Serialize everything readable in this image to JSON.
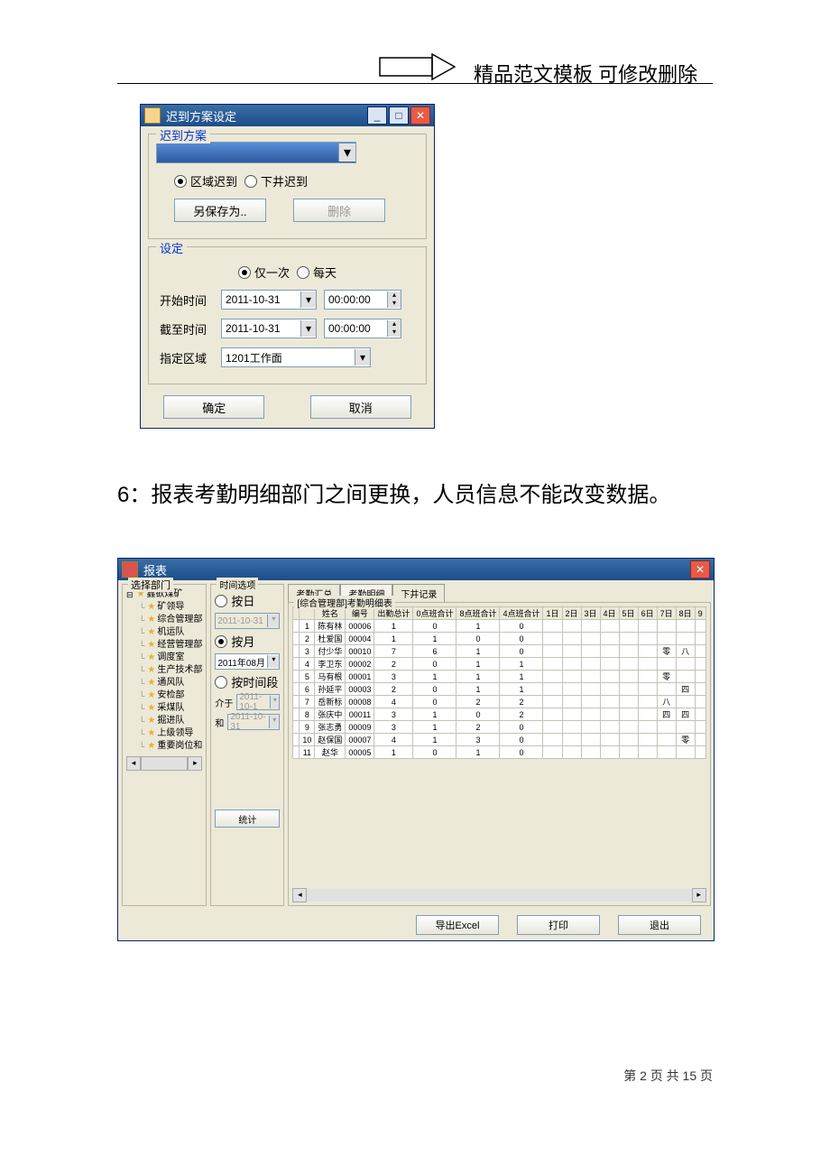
{
  "header": {
    "text": "精品范文模板  可修改删除"
  },
  "body_text": "6：报表考勤明细部门之间更换，人员信息不能改变数据。",
  "footer": {
    "page_current": "2",
    "page_total": "15",
    "template": "第 {c} 页 共 {t} 页"
  },
  "dialog1": {
    "title": "迟到方案设定",
    "group1_title": "迟到方案",
    "radio_area": "区域迟到",
    "radio_down": "下井迟到",
    "btn_saveas": "另保存为..",
    "btn_delete": "删除",
    "group2_title": "设定",
    "radio_once": "仅一次",
    "radio_daily": "每天",
    "label_start": "开始时间",
    "label_end": "截至时间",
    "date_value": "2011-10-31",
    "time_value": "00:00:00",
    "label_zone": "指定区域",
    "zone_value": "1201工作面",
    "btn_ok": "确定",
    "btn_cancel": "取消"
  },
  "dialog2": {
    "title": "报表",
    "dept_title": "选择部门",
    "tree": [
      {
        "t": "鑫欲煤矿",
        "root": true
      },
      {
        "t": "矿领导"
      },
      {
        "t": "综合管理部"
      },
      {
        "t": "机运队"
      },
      {
        "t": "经营管理部"
      },
      {
        "t": "调度室"
      },
      {
        "t": "生产技术部"
      },
      {
        "t": "通风队"
      },
      {
        "t": "安检部"
      },
      {
        "t": "采煤队"
      },
      {
        "t": "掘进队"
      },
      {
        "t": "上级领导"
      },
      {
        "t": "重要岗位和"
      }
    ],
    "time_title": "时间选项",
    "r_day": "按日",
    "day_value": "2011-10-31",
    "r_month": "按月",
    "month_value": "2011年08月",
    "r_range": "按时间段",
    "range_from_label": "介于",
    "range_from": "2011-10-1",
    "range_to_label": "和",
    "range_to": "2011-10-31",
    "btn_stat": "统计",
    "tabs": [
      "考勤汇总",
      "考勤明细",
      "下井记录"
    ],
    "table_title": "[综合管理部]考勤明细表",
    "columns": [
      "",
      "",
      "姓名",
      "编号",
      "出勤总计",
      "0点班合计",
      "8点班合计",
      "4点班合计",
      "1日",
      "2日",
      "3日",
      "4日",
      "5日",
      "6日",
      "7日",
      "8日",
      "9"
    ],
    "rows": [
      [
        "",
        "1",
        "陈有林",
        "00006",
        "1",
        "0",
        "1",
        "0",
        "",
        "",
        "",
        "",
        "",
        "",
        "",
        "",
        ""
      ],
      [
        "",
        "2",
        "杜爱国",
        "00004",
        "1",
        "1",
        "0",
        "0",
        "",
        "",
        "",
        "",
        "",
        "",
        "",
        "",
        ""
      ],
      [
        "",
        "3",
        "付少华",
        "00010",
        "7",
        "6",
        "1",
        "0",
        "",
        "",
        "",
        "",
        "",
        "",
        "零",
        "八",
        ""
      ],
      [
        "",
        "4",
        "李卫东",
        "00002",
        "2",
        "0",
        "1",
        "1",
        "",
        "",
        "",
        "",
        "",
        "",
        "",
        "",
        ""
      ],
      [
        "",
        "5",
        "马有根",
        "00001",
        "3",
        "1",
        "1",
        "1",
        "",
        "",
        "",
        "",
        "",
        "",
        "零",
        "",
        ""
      ],
      [
        "",
        "6",
        "孙延平",
        "00003",
        "2",
        "0",
        "1",
        "1",
        "",
        "",
        "",
        "",
        "",
        "",
        "",
        "四",
        ""
      ],
      [
        "",
        "7",
        "岳新标",
        "00008",
        "4",
        "0",
        "2",
        "2",
        "",
        "",
        "",
        "",
        "",
        "",
        "八",
        "",
        ""
      ],
      [
        "",
        "8",
        "张庆中",
        "00011",
        "3",
        "1",
        "0",
        "2",
        "",
        "",
        "",
        "",
        "",
        "",
        "四",
        "四",
        ""
      ],
      [
        "",
        "9",
        "张志勇",
        "00009",
        "3",
        "1",
        "2",
        "0",
        "",
        "",
        "",
        "",
        "",
        "",
        "",
        "",
        ""
      ],
      [
        "",
        "10",
        "赵保国",
        "00007",
        "4",
        "1",
        "3",
        "0",
        "",
        "",
        "",
        "",
        "",
        "",
        "",
        "零",
        ""
      ],
      [
        "",
        "11",
        "赵华",
        "00005",
        "1",
        "0",
        "1",
        "0",
        "",
        "",
        "",
        "",
        "",
        "",
        "",
        "",
        ""
      ]
    ],
    "btn_export": "导出Excel",
    "btn_print": "打印",
    "btn_exit": "退出"
  }
}
